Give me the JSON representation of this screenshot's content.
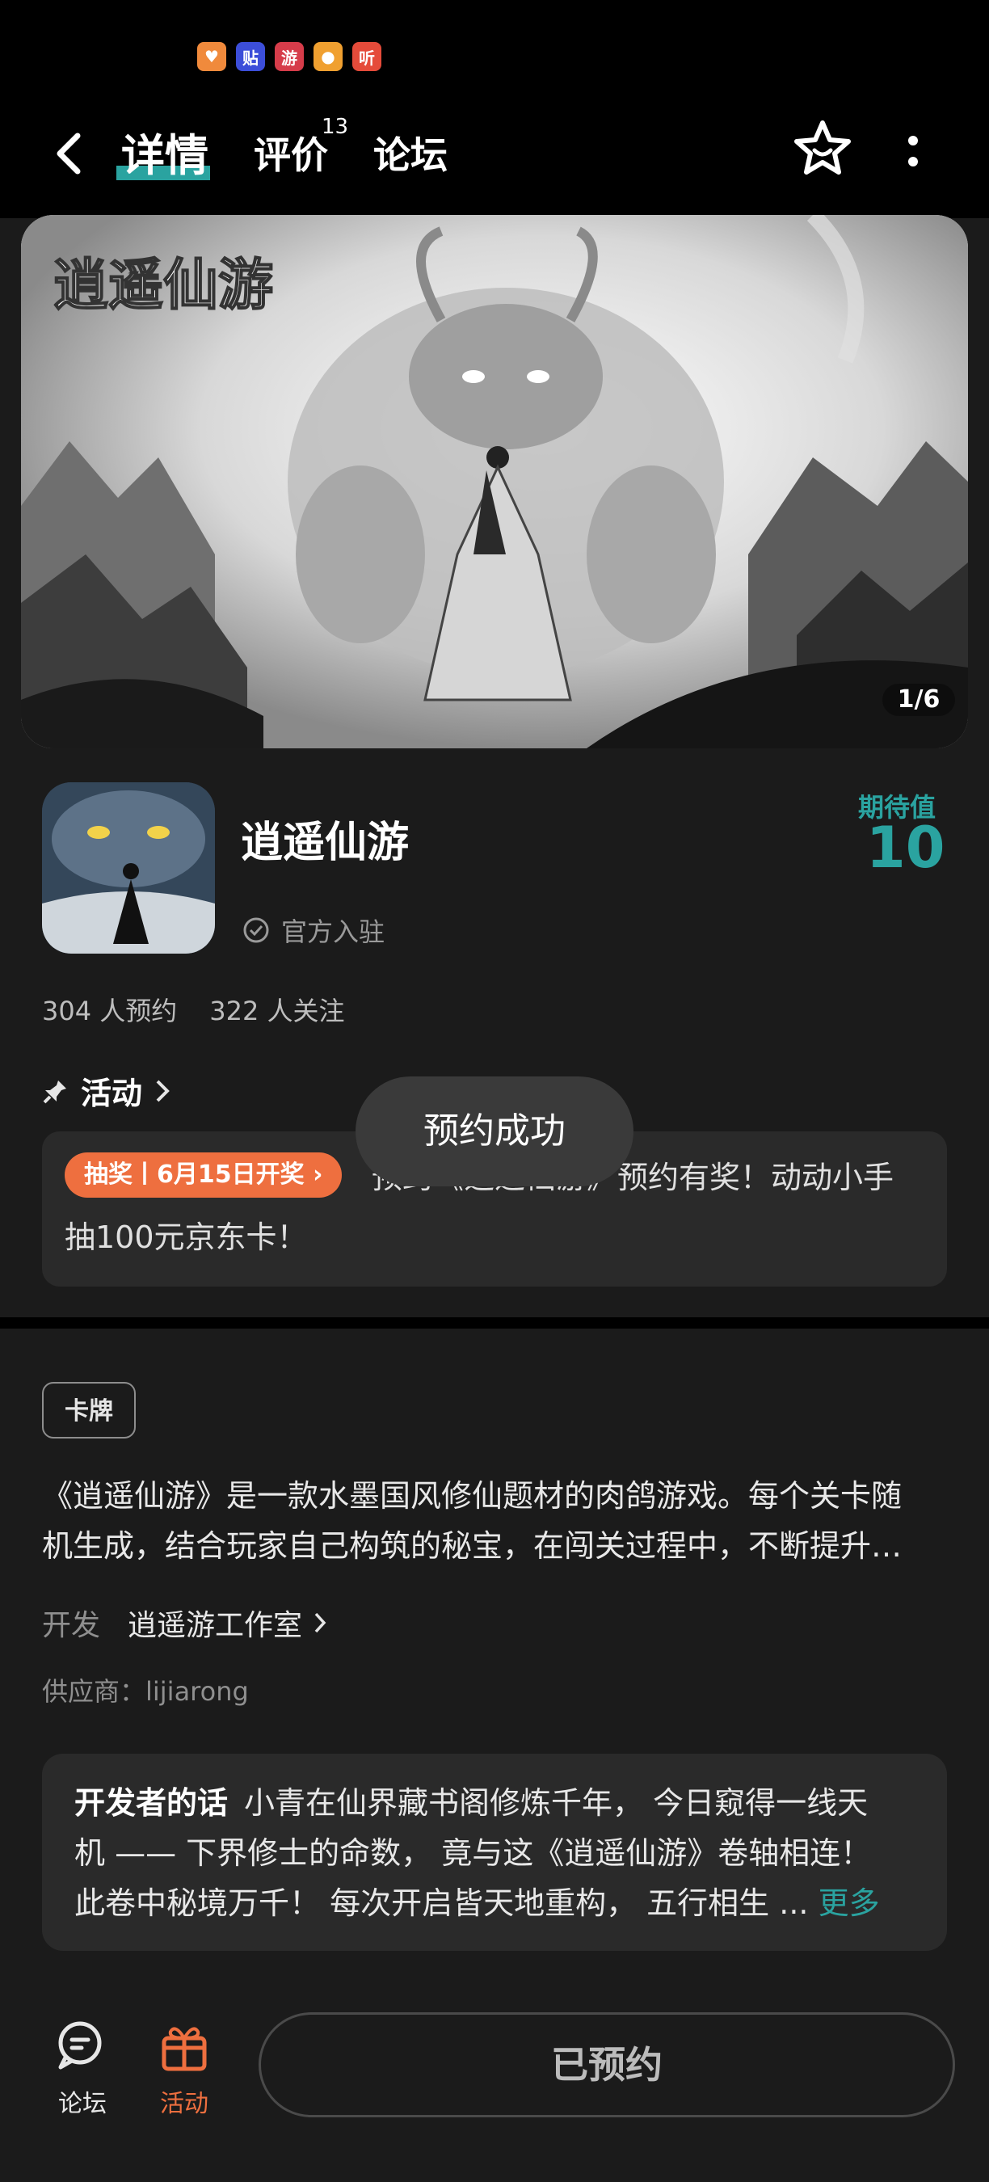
{
  "status_bar": {
    "icons": [
      {
        "name": "heart-app-icon",
        "glyph": "♥",
        "color": "#f08a3c"
      },
      {
        "name": "tieba-app-icon",
        "glyph": "贴",
        "color": "#3c4ed9"
      },
      {
        "name": "game-app-icon",
        "glyph": "游",
        "color": "#d63c4a"
      },
      {
        "name": "fruit-app-icon",
        "glyph": "●",
        "color": "#f0a030"
      },
      {
        "name": "listen-app-icon",
        "glyph": "听",
        "color": "#e54b3a"
      }
    ]
  },
  "header": {
    "tabs": [
      {
        "label": "详情",
        "active": true
      },
      {
        "label": "评价",
        "badge": "13"
      },
      {
        "label": "论坛"
      }
    ]
  },
  "banner": {
    "logo_text": "逍遥仙游",
    "pager": "1/6"
  },
  "game": {
    "title": "逍遥仙游",
    "official_label": "官方入驻",
    "expectation_label": "期待值",
    "expectation_value": "10",
    "reservations": "304 人预约",
    "followers": "322 人关注"
  },
  "activity": {
    "section_title": "活动",
    "chip": "抽奖丨6月15日开奖",
    "text": "预约《逍遥仙游》预约有奖！动动小手抽100元京东卡！"
  },
  "toast": "预约成功",
  "details": {
    "tag": "卡牌",
    "description_lines": [
      "《逍遥仙游》是一款水墨国风修仙题材的肉鸽游戏。每个关卡随",
      "机生成，结合玩家自己构筑的秘宝，在闯关过程中，不断提升…"
    ],
    "developer_label": "开发",
    "developer_name": "逍遥游工作室",
    "supplier": "供应商：lijiarong"
  },
  "dev_words": {
    "title": "开发者的话",
    "lines": [
      "小青在仙界藏书阁修炼千年， 今日窥得一线天",
      "机 —— 下界修士的命数， 竟与这《逍遥仙游》卷轴相连！",
      "此卷中秘境万千！ 每次开启皆天地重构， 五行相生 ... "
    ],
    "more": "更多"
  },
  "bottom_bar": {
    "forum_label": "论坛",
    "activity_label": "活动",
    "reserve_button": "已预约"
  },
  "colors": {
    "accent": "#2aa3a0",
    "activity": "#ee6f3f",
    "background": "#1b1b1b",
    "card": "#2a2a2a"
  }
}
